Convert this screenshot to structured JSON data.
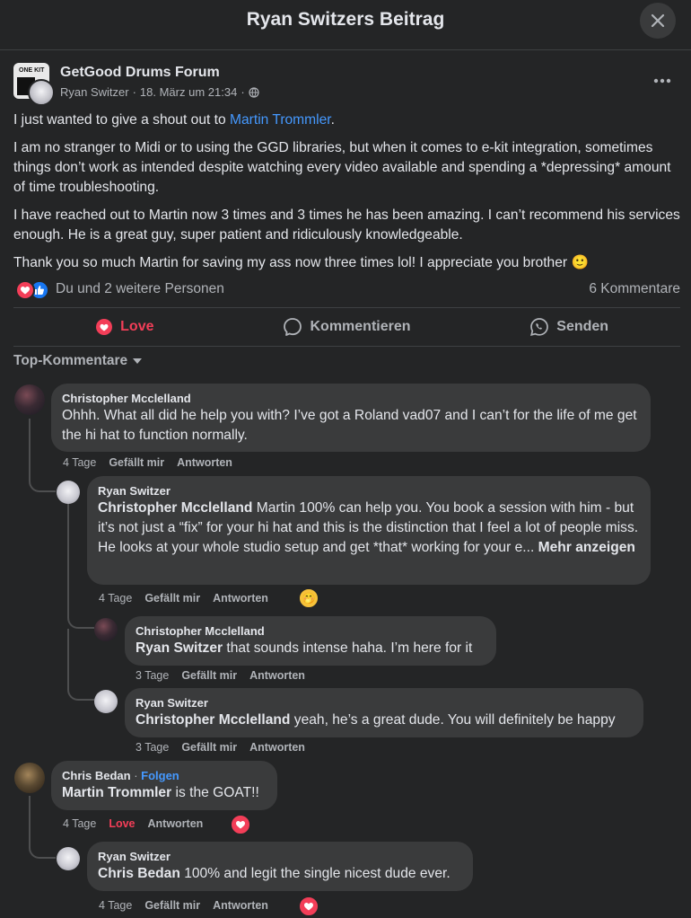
{
  "header": {
    "title": "Ryan Switzers Beitrag",
    "close_icon": "close-icon"
  },
  "post": {
    "group_name": "GetGood Drums Forum",
    "logo_text": "ONE KIT",
    "author": "Ryan Switzer",
    "date": "18. März um 21:34",
    "separator": "·",
    "privacy_icon": "globe-icon",
    "paragraphs": {
      "p1_before": "I just wanted to give a shout out to ",
      "p1_mention": "Martin Trommler",
      "p1_after": ".",
      "p2": "I am no stranger to Midi or to using the GGD libraries, but when it comes to e-kit integration, sometimes things don’t work as intended despite watching every video available and spending a *depressing* amount of time troubleshooting.",
      "p3": "I have reached out to Martin now 3 times and 3 times he has been amazing. I can’t recommend his services enough. He is a great guy, super patient and ridiculously knowledgeable.",
      "p4": "Thank you so much Martin for saving my ass now three times lol! I appreciate you brother"
    },
    "emoji": "🙂",
    "reactions_text": "Du und 2 weitere Personen",
    "comment_count": "6 Kommentare"
  },
  "actions": {
    "love": "Love",
    "comment": "Kommentieren",
    "send": "Senden"
  },
  "sort_label": "Top-Kommentare",
  "colors": {
    "accent": "#4599ff",
    "love": "#f33e58",
    "like": "#1877f2",
    "bubble": "#3a3b3c",
    "bg": "#242526"
  },
  "comments": {
    "c1": {
      "name": "Christopher Mcclelland",
      "text": "Ohhh. What all did he help you with? I’ve got a Roland vad07 and I can’t for the life of me get the hi hat to function normally.",
      "time": "4 Tage",
      "like": "Gefällt mir",
      "reply": "Antworten"
    },
    "r1": {
      "name": "Ryan Switzer",
      "mention": "Christopher Mcclelland",
      "text": " Martin 100% can help you. You book a session with him - but it’s not just a “fix” for your hi hat and this is the distinction that I feel a lot of people miss. He looks at your whole studio setup and get *that* working for your e... ",
      "more": "Mehr anzeigen",
      "time": "4 Tage",
      "like": "Gefällt mir",
      "reply": "Antworten",
      "reaction": "🤭"
    },
    "r2": {
      "name": "Christopher Mcclelland",
      "mention": "Ryan Switzer",
      "text": " that sounds intense haha. I’m here for it",
      "time": "3 Tage",
      "like": "Gefällt mir",
      "reply": "Antworten"
    },
    "r3": {
      "name": "Ryan Switzer",
      "mention": "Christopher Mcclelland",
      "text": " yeah, he’s a great dude. You will definitely be happy",
      "time": "3 Tage",
      "like": "Gefällt mir",
      "reply": "Antworten"
    },
    "c2": {
      "name": "Chris Bedan",
      "dot": " · ",
      "follow": "Folgen",
      "mention": "Martin Trommler",
      "text": " is the GOAT!!",
      "time": "4 Tage",
      "like": "Love",
      "reply": "Antworten"
    },
    "r4": {
      "name": "Ryan Switzer",
      "mention": "Chris Bedan",
      "text": " 100% and legit the single nicest dude ever.",
      "time": "4 Tage",
      "like": "Gefällt mir",
      "reply": "Antworten"
    }
  }
}
